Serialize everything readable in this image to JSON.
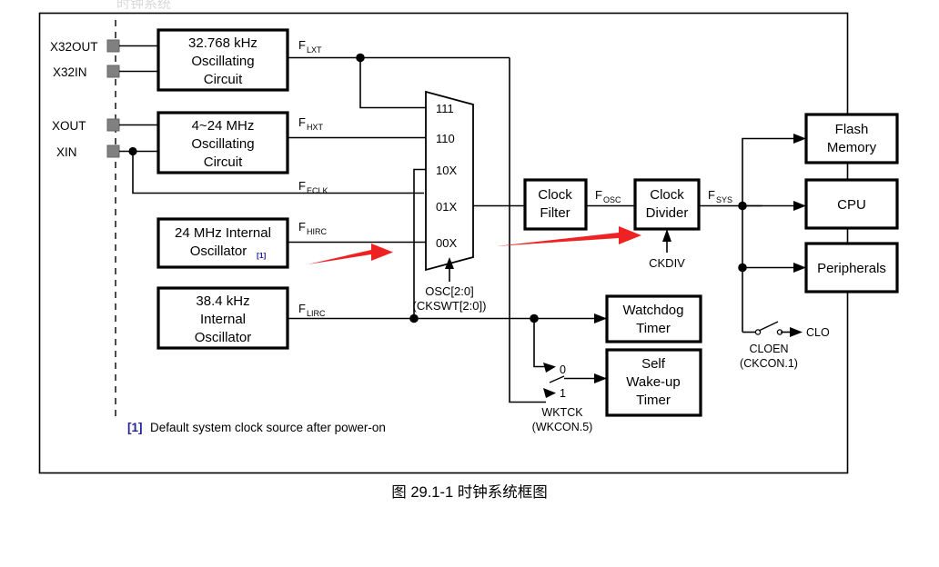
{
  "caption": "图 29.1-1 时钟系统框图",
  "top_partial_text": "时钟系统",
  "pins": [
    {
      "label": "X32OUT"
    },
    {
      "label": "X32IN"
    },
    {
      "label": "XOUT"
    },
    {
      "label": "XIN"
    }
  ],
  "oscillator_blocks": [
    {
      "id": "lxt",
      "lines": [
        "32.768 kHz",
        "Oscillating",
        "Circuit"
      ],
      "output_signal": "F",
      "output_sub": "LXT"
    },
    {
      "id": "hxt",
      "lines": [
        "4~24 MHz",
        "Oscillating",
        "Circuit"
      ],
      "output_signal": "F",
      "output_sub": "HXT"
    },
    {
      "id": "hirc",
      "lines": [
        "24 MHz Internal",
        "Oscillator"
      ],
      "footnote_marker": "[1]",
      "output_signal": "F",
      "output_sub": "HIRC"
    },
    {
      "id": "lirc",
      "lines": [
        "38.4 kHz",
        "Internal",
        "Oscillator"
      ],
      "output_signal": "F",
      "output_sub": "LIRC"
    }
  ],
  "external_clock_signal": {
    "signal": "F",
    "sub": "ECLK"
  },
  "mux": {
    "inputs": [
      "111",
      "110",
      "10X",
      "01X",
      "00X"
    ],
    "control_label": "OSC[2:0]",
    "control_register": "(CKSWT[2:0])"
  },
  "clock_filter": {
    "lines": [
      "Clock",
      "Filter"
    ]
  },
  "clock_divider": {
    "lines": [
      "Clock",
      "Divider"
    ],
    "control_label": "CKDIV"
  },
  "signals": {
    "fosc": {
      "signal": "F",
      "sub": "OSC"
    },
    "fsys": {
      "signal": "F",
      "sub": "SYS"
    }
  },
  "destination_blocks": [
    {
      "lines": [
        "Flash",
        "Memory"
      ]
    },
    {
      "lines": [
        "CPU"
      ]
    },
    {
      "lines": [
        "Peripherals"
      ]
    }
  ],
  "timer_blocks": [
    {
      "lines": [
        "Watchdog",
        "Timer"
      ]
    },
    {
      "lines": [
        "Self",
        "Wake-up",
        "Timer"
      ]
    }
  ],
  "wktck_switch": {
    "input_0_label": "0",
    "input_1_label": "1",
    "name": "WKTCK",
    "register": "(WKCON.5)"
  },
  "clo_switch": {
    "name": "CLOEN",
    "register": "(CKCON.1)",
    "output_label": "CLO"
  },
  "footnote": {
    "marker": "[1]",
    "text": "Default system clock source after power-on"
  },
  "colors": {
    "annotation_red": "#ee2222",
    "footnote_blue": "#22229c",
    "pin_gray": "#808080",
    "line_black": "#000000"
  }
}
